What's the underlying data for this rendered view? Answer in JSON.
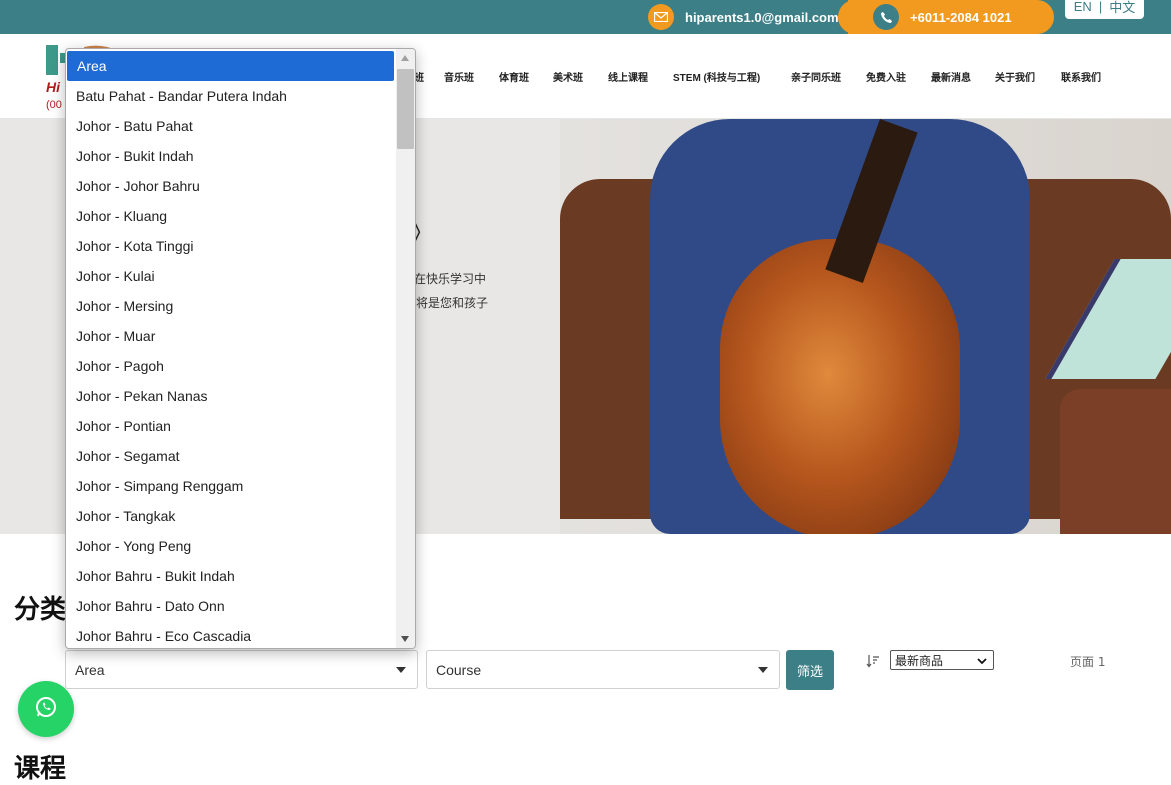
{
  "topbar": {
    "email": "hiparents1.0@gmail.com",
    "phone": "+6011-2084 1021",
    "lang_en": "EN",
    "lang_sep": "|",
    "lang_zh": "中文"
  },
  "logo": {
    "text_partial": "Hi",
    "tel_partial": "(00"
  },
  "nav": {
    "items": [
      "班",
      "音乐班",
      "体育班",
      "美术班",
      "线上课程",
      "STEM (科技与工程)",
      "亲子同乐班",
      "免费入驻",
      "最新消息",
      "关于我们",
      "联系我们"
    ]
  },
  "hero": {
    "title_partial": "》",
    "line1_partial": "在快乐学习中",
    "line2_partial": "将是您和孩子"
  },
  "filter": {
    "section_title_partial": "分类",
    "area_value": "Area",
    "course_value": "Course",
    "filter_button": "筛选",
    "sort_value": "最新商品",
    "page_label": "页面 1"
  },
  "courses_title": "课程",
  "area_dropdown": {
    "options": [
      "Area",
      "Batu Pahat - Bandar Putera Indah",
      "Johor - Batu Pahat",
      "Johor - Bukit Indah",
      "Johor - Johor Bahru",
      "Johor - Kluang",
      "Johor - Kota Tinggi",
      "Johor - Kulai",
      "Johor - Mersing",
      "Johor - Muar",
      "Johor - Pagoh",
      "Johor - Pekan Nanas",
      "Johor - Pontian",
      "Johor - Segamat",
      "Johor - Simpang Renggam",
      "Johor - Tangkak",
      "Johor - Yong Peng",
      "Johor Bahru - Bukit Indah",
      "Johor Bahru - Dato Onn",
      "Johor Bahru - Eco Cascadia"
    ],
    "selected_index": 0
  },
  "colors": {
    "teal": "#3d7f86",
    "orange": "#f29a1f",
    "selected_blue": "#1f6bd6",
    "whatsapp_green": "#25d366"
  },
  "icons": {
    "email": "envelope-icon",
    "phone": "phone-icon",
    "whatsapp": "whatsapp-icon",
    "sort": "sort-icon"
  }
}
